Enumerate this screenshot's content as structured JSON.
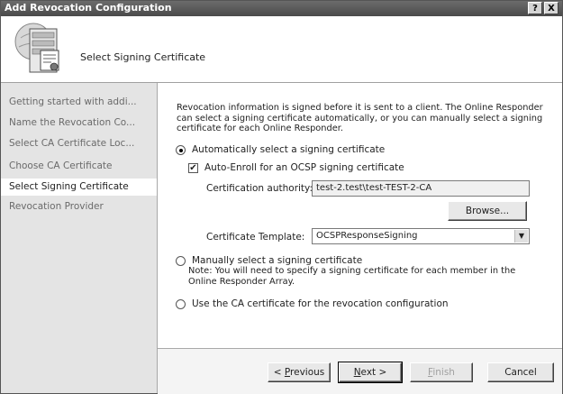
{
  "window": {
    "title": "Add Revocation Configuration",
    "help_label": "?",
    "close_label": "X"
  },
  "header": {
    "step_title": "Select Signing Certificate"
  },
  "sidebar": {
    "items": [
      {
        "label": "Getting started with addi..."
      },
      {
        "label": "Name the Revocation Co..."
      },
      {
        "label": "Select CA Certificate Loc..."
      },
      {
        "label": "Choose CA Certificate"
      },
      {
        "label": "Select Signing Certificate"
      },
      {
        "label": "Revocation Provider"
      }
    ]
  },
  "content": {
    "description": "Revocation information is signed before it is sent to a client. The Online Responder can select a signing certificate automatically, or you can manually select a signing certificate for each Online Responder.",
    "option_auto": "Automatically select a signing certificate",
    "auto_enroll": "Auto-Enroll for an OCSP signing certificate",
    "ca_label": "Certification authority:",
    "ca_value": "test-2.test\\test-TEST-2-CA",
    "browse_label": "Browse...",
    "template_label": "Certificate Template:",
    "template_value": "OCSPResponseSigning",
    "option_manual": "Manually select a signing certificate",
    "manual_note": "Note: You will need to specify a signing certificate for each member in the Online Responder Array.",
    "option_ca": "Use the CA certificate for the revocation configuration"
  },
  "footer": {
    "previous_prefix": "< ",
    "previous_u": "P",
    "previous_rest": "revious",
    "next_u": "N",
    "next_rest": "ext >",
    "finish_u": "F",
    "finish_rest": "inish",
    "cancel": "Cancel"
  }
}
